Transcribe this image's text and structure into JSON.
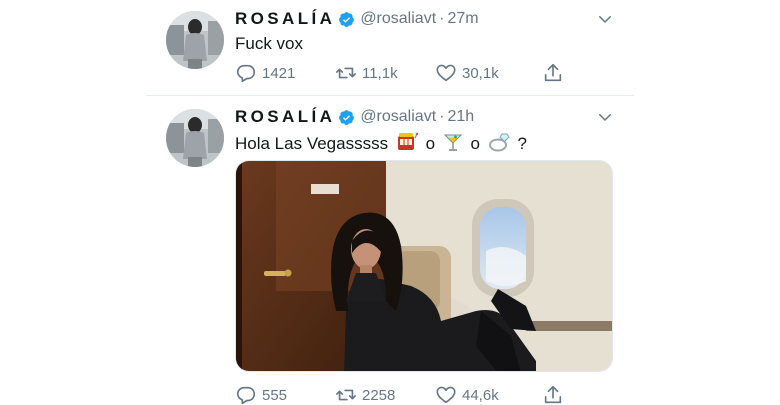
{
  "tweets": [
    {
      "author_name": "ROSALÍA",
      "handle": "@rosaliavt",
      "separator": "·",
      "time": "27m",
      "text": "Fuck vox",
      "replies": "1421",
      "retweets": "11,1k",
      "likes": "30,1k"
    },
    {
      "author_name": "ROSALÍA",
      "handle": "@rosaliavt",
      "separator": "·",
      "time": "21h",
      "text_parts": [
        "Hola Las Vegasssss",
        "o",
        "o",
        "?"
      ],
      "emoji_icons": [
        "slot-machine-icon",
        "cocktail-icon",
        "ring-icon"
      ],
      "replies": "555",
      "retweets": "2258",
      "likes": "44,6k"
    }
  ],
  "colors": {
    "text": "#14171a",
    "secondary": "#657786",
    "verified": "#1da1f2",
    "divider": "#e6ecf0"
  }
}
